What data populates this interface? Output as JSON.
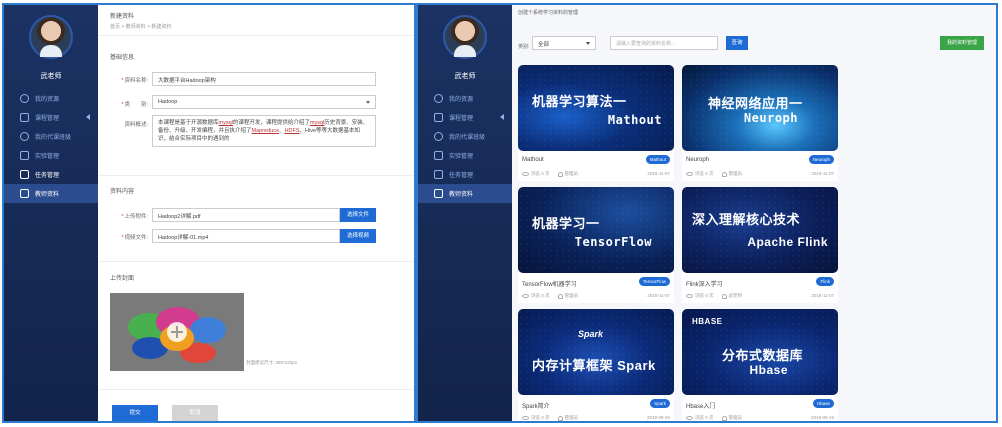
{
  "left": {
    "username": "武老师",
    "nav": [
      {
        "label": "我的资源",
        "icon": "gauge-icon"
      },
      {
        "label": "课程管理",
        "icon": "calendar-icon"
      },
      {
        "label": "我的代课班级",
        "icon": "users-icon"
      },
      {
        "label": "实验管理",
        "icon": "monitor-icon"
      },
      {
        "label": "任务管理",
        "icon": "task-icon"
      },
      {
        "label": "教师资料",
        "icon": "folder-icon"
      }
    ],
    "page_title": "新建资料",
    "breadcrumb": "首页 > 教师资料 > 新建资料",
    "basic_info": "基础信息",
    "name_label": "资料名称:",
    "name_value": "大数据平台Hadoop架构",
    "type_label": "类　　别:",
    "type_value": "Hadoop",
    "desc_label": "资料概述:",
    "desc_pre": "本课程是基于开源数据库",
    "desc_link1": "mysql",
    "desc_mid1": "的课程开发，课程提供给介绍了",
    "desc_link2": "mysql",
    "desc_mid2": "历史背景、安装、备份、升级、开发编程，并且执介绍了",
    "desc_link3": "Mapreduce",
    "desc_sep": "、",
    "desc_link4": "HDFS",
    "desc_post": "、Hive等等大数据基本知识，结合实际项目中的遇到的",
    "content_section": "资料内容",
    "upload_label": "上传附件:",
    "upload_value": "Hadoop2详解.pdf",
    "upload_btn": "选择文件",
    "video_label": "视频文件:",
    "video_value": "Hadoop详解-01.mp4",
    "video_btn": "选择视频",
    "cover_section": "上传封面",
    "cover_hint": "封面建议尺寸: 380*220px",
    "submit": "提交",
    "cancel": "取消"
  },
  "right": {
    "username": "武老师",
    "nav": [
      {
        "label": "我的资源",
        "icon": "gauge-icon"
      },
      {
        "label": "课程管理",
        "icon": "calendar-icon"
      },
      {
        "label": "我的代课班级",
        "icon": "users-icon"
      },
      {
        "label": "实验管理",
        "icon": "monitor-icon"
      },
      {
        "label": "任务管理",
        "icon": "task-icon"
      },
      {
        "label": "教师资料",
        "icon": "folder-icon"
      }
    ],
    "page_title": "创建个系统学习资料的管理",
    "filter_label": "类别:",
    "filter_value": "全部",
    "search_placeholder": "请输入要查询的资料名称...",
    "search_btn": "查询",
    "my_btn": "我的资料管理",
    "cards": [
      {
        "line1": "机器学习算法一",
        "line2": "Mathout",
        "name": "Mathout",
        "tag": "Mathout",
        "views": "浏览 0 次",
        "author": "管理员",
        "date": "2018-11-07"
      },
      {
        "line1": "神经网络应用一",
        "line2": "Neuroph",
        "name": "Neuroph",
        "tag": "Neuroph",
        "views": "浏览 0 次",
        "author": "管理员",
        "date": "2018-11-07"
      },
      {
        "line1": "机器学习一",
        "line2": "TensorFlow",
        "name": "TensorFlow机器学习",
        "tag": "TensorFlow",
        "views": "浏览 0 次",
        "author": "管理员",
        "date": "2018-11-07"
      },
      {
        "line1": "深入理解核心技术",
        "line2": "Apache Flink",
        "name": "Flink深入学习",
        "tag": "Flink",
        "views": "浏览 0 次",
        "author": "武老师",
        "date": "2018-11-07"
      },
      {
        "line1": "内存计算框架 Spark",
        "line2": "",
        "logo": "Spark",
        "name": "Spark简介",
        "tag": "Spark",
        "views": "浏览 0 次",
        "author": "管理员",
        "date": "2018-09-25"
      },
      {
        "line1": "分布式数据库",
        "line2": "Hbase",
        "logo": "HBASE",
        "name": "Hbase入门",
        "tag": "Hbase",
        "views": "浏览 0 次",
        "author": "管理员",
        "date": "2018-09-15"
      }
    ]
  },
  "colors": {
    "sidebar": "#162a55",
    "primary": "#1e6bd6",
    "green": "#39a548",
    "border": "#2e7bcf"
  }
}
